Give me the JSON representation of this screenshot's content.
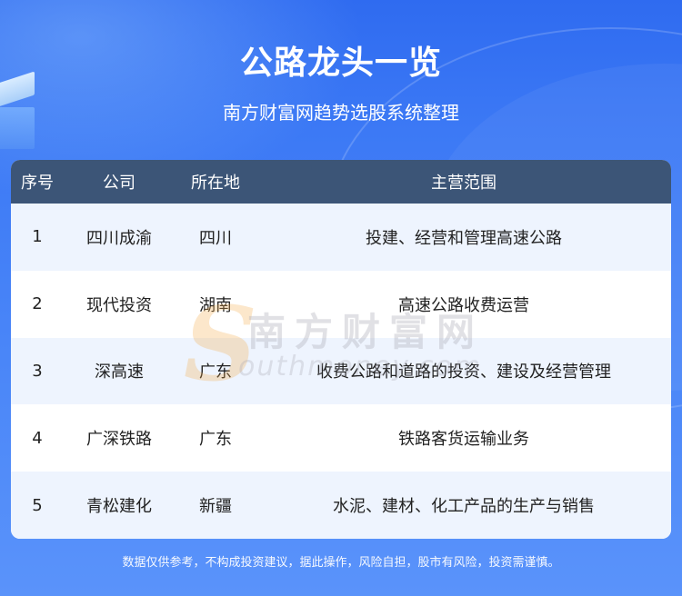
{
  "header": {
    "title": "公路龙头一览",
    "subtitle": "南方财富网趋势选股系统整理"
  },
  "table": {
    "columns": [
      "序号",
      "公司",
      "所在地",
      "主营范围"
    ],
    "rows": [
      {
        "no": "1",
        "company": "四川成渝",
        "location": "四川",
        "business": "投建、经营和管理高速公路"
      },
      {
        "no": "2",
        "company": "现代投资",
        "location": "湖南",
        "business": "高速公路收费运营"
      },
      {
        "no": "3",
        "company": "深高速",
        "location": "广东",
        "business": "收费公路和道路的投资、建设及经营管理"
      },
      {
        "no": "4",
        "company": "广深铁路",
        "location": "广东",
        "business": "铁路客货运输业务"
      },
      {
        "no": "5",
        "company": "青松建化",
        "location": "新疆",
        "business": "水泥、建材、化工产品的生产与销售"
      }
    ]
  },
  "watermark": {
    "letter": "S",
    "cn_text": "南方财富网",
    "en_text": "outhmoney.com"
  },
  "footer": {
    "disclaimer": "数据仅供参考，不构成投资建议，据此操作，风险自担，股市有风险，投资需谨慎。"
  },
  "colors": {
    "background": "#3c79f5",
    "table_header": "#3c5577",
    "row_stripe": "#eef4fe"
  }
}
